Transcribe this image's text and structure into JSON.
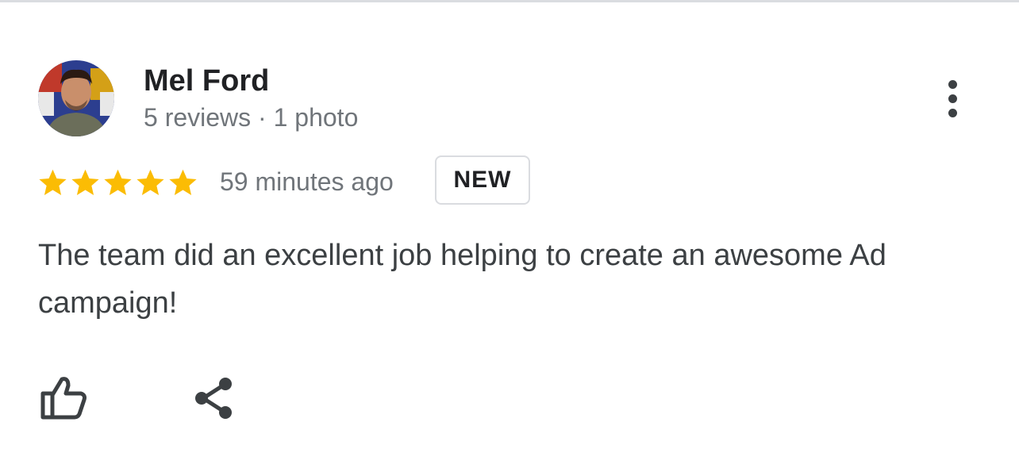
{
  "reviewer": {
    "name": "Mel Ford",
    "meta": "5 reviews · 1 photo",
    "avatar_icon": "user-photo"
  },
  "rating": {
    "stars": 5,
    "max_stars": 5,
    "star_color": "#fbbc04"
  },
  "review": {
    "time_ago": "59 minutes ago",
    "badge": "NEW",
    "text": "The team did an excellent job helping to create an awesome Ad campaign!"
  },
  "actions": {
    "more_icon": "more-vertical-icon",
    "like_icon": "thumbs-up-icon",
    "share_icon": "share-icon"
  },
  "colors": {
    "primary_text": "#202124",
    "secondary_text": "#70757a",
    "icon": "#3c4043",
    "divider": "#dadce0"
  }
}
